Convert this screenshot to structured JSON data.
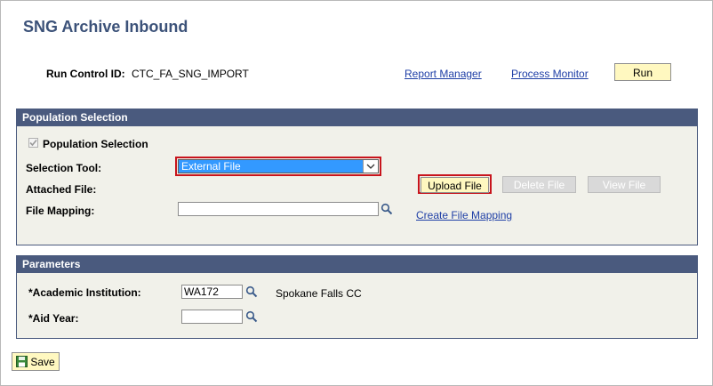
{
  "page": {
    "title": "SNG Archive Inbound"
  },
  "header": {
    "run_control_label": "Run Control ID:",
    "run_control_value": "CTC_FA_SNG_IMPORT",
    "report_manager_link": "Report Manager",
    "process_monitor_link": "Process Monitor",
    "run_button": "Run"
  },
  "population_selection": {
    "header": "Population Selection",
    "checkbox_label": "Population Selection",
    "checkbox_checked": true,
    "selection_tool_label": "Selection Tool:",
    "selection_tool_value": "External File",
    "attached_file_label": "Attached File:",
    "file_mapping_label": "File Mapping:",
    "file_mapping_value": "",
    "upload_file_button": "Upload File",
    "delete_file_button": "Delete File",
    "view_file_button": "View File",
    "create_file_mapping_link": "Create File Mapping"
  },
  "parameters": {
    "header": "Parameters",
    "institution_label": "*Academic Institution:",
    "institution_value": "WA172",
    "institution_description": "Spokane Falls CC",
    "aid_year_label": "*Aid Year:",
    "aid_year_value": ""
  },
  "footer": {
    "save_button": "Save"
  },
  "colors": {
    "panel_header": "#4a5a7e",
    "title": "#3c5279",
    "link": "#1f3fa6",
    "highlight": "#c8141c",
    "select_bg": "#3399ff"
  }
}
